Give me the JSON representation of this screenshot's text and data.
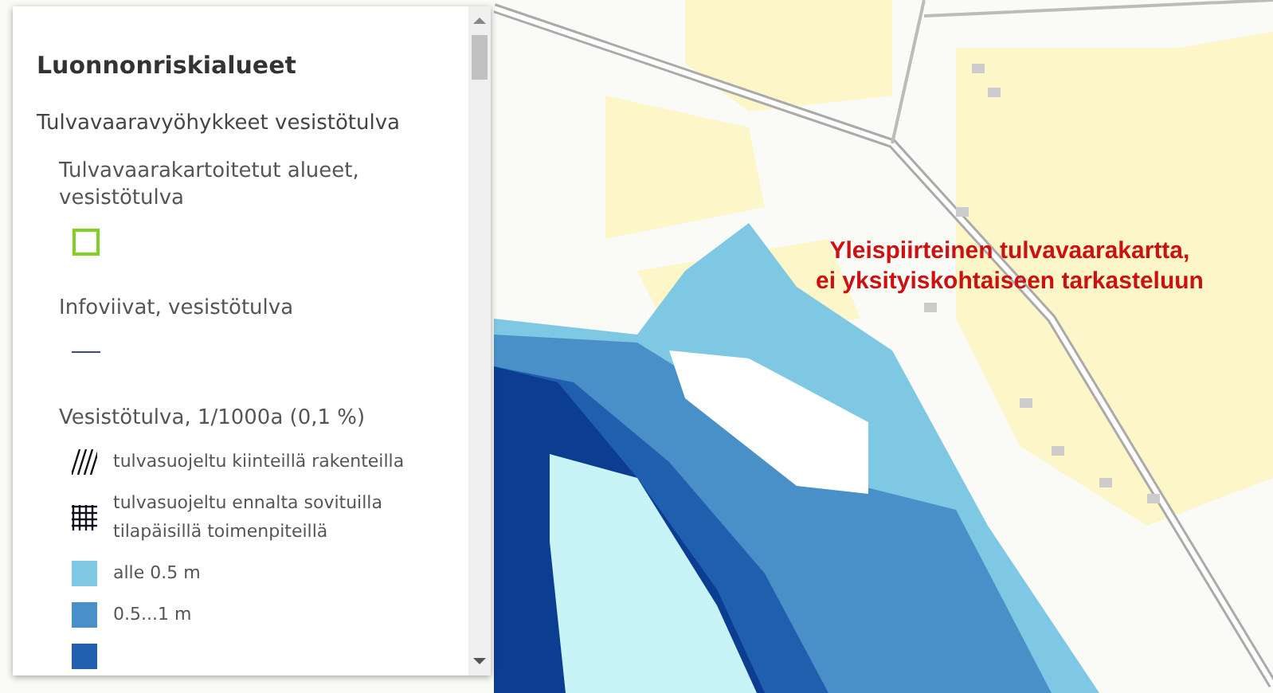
{
  "map": {
    "notice_lines": [
      "Yleispiirteinen tulvavaarakartta,",
      "ei yksityiskohtaiseen tarkasteluun"
    ]
  },
  "legend": {
    "title": "Luonnonriskialueet",
    "group": "Tulvavaaravyöhykkeet vesistötulva",
    "layers": [
      {
        "name": "Tulvavaarakartoitetut alueet, vesistötulva",
        "symbols": [
          {
            "kind": "outline",
            "color": "#7ed321"
          }
        ]
      },
      {
        "name": "Infoviivat, vesistötulva",
        "symbols": [
          {
            "kind": "line",
            "color": "#3a4a8a"
          }
        ]
      },
      {
        "name": "Vesistötulva, 1/1000a (0,1 %)",
        "symbols": [
          {
            "kind": "hatch",
            "label": "tulvasuojeltu kiinteillä rakenteilla"
          },
          {
            "kind": "grid",
            "label": "tulvasuojeltu ennalta sovituilla tilapäisillä toimenpiteillä"
          },
          {
            "kind": "fill",
            "color": "#7ec8e3",
            "label": "alle 0.5 m"
          },
          {
            "kind": "fill",
            "color": "#4a90c8",
            "label": "0.5...1 m"
          },
          {
            "kind": "fill",
            "color": "#1f5fae"
          }
        ]
      }
    ]
  }
}
